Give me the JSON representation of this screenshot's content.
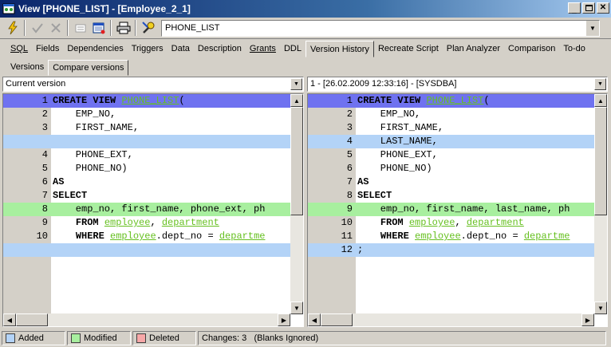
{
  "window": {
    "title": "View [PHONE_LIST] - [Employee_2_1]"
  },
  "toolbar": {
    "object_name": "PHONE_LIST"
  },
  "tabs": [
    {
      "label": "SQL",
      "active": false
    },
    {
      "label": "Fields",
      "active": false
    },
    {
      "label": "Dependencies",
      "active": false
    },
    {
      "label": "Triggers",
      "active": false
    },
    {
      "label": "Data",
      "active": false
    },
    {
      "label": "Description",
      "active": false
    },
    {
      "label": "Grants",
      "active": false
    },
    {
      "label": "DDL",
      "active": false
    },
    {
      "label": "Version History",
      "active": true
    },
    {
      "label": "Recreate Script",
      "active": false
    },
    {
      "label": "Plan Analyzer",
      "active": false
    },
    {
      "label": "Comparison",
      "active": false
    },
    {
      "label": "To-do",
      "active": false
    }
  ],
  "subtabs": [
    {
      "label": "Versions",
      "active": false
    },
    {
      "label": "Compare versions",
      "active": true
    }
  ],
  "left_version": "Current version",
  "right_version": "1 - [26.02.2009 12:33:16] - [SYSDBA]",
  "colors": {
    "added": "#b3d3f7",
    "modified": "#a8ef9f",
    "deleted": "#f7a8a8",
    "first_line": "#6f72f0"
  },
  "left_lines": [
    {
      "num": "1",
      "text": "CREATE VIEW PHONE_LIST("
    },
    {
      "num": "2",
      "text": "    EMP_NO,"
    },
    {
      "num": "3",
      "text": "    FIRST_NAME,"
    },
    {
      "num": "",
      "text": ""
    },
    {
      "num": "4",
      "text": "    PHONE_EXT,"
    },
    {
      "num": "5",
      "text": "    PHONE_NO)"
    },
    {
      "num": "6",
      "text": "AS"
    },
    {
      "num": "7",
      "text": "SELECT"
    },
    {
      "num": "8",
      "text": "    emp_no, first_name, phone_ext, ph"
    },
    {
      "num": "9",
      "text": "    FROM employee, department"
    },
    {
      "num": "10",
      "text": "    WHERE employee.dept_no = departme"
    },
    {
      "num": "",
      "text": ""
    }
  ],
  "right_lines": [
    {
      "num": "1",
      "text": "CREATE VIEW PHONE_LIST("
    },
    {
      "num": "2",
      "text": "    EMP_NO,"
    },
    {
      "num": "3",
      "text": "    FIRST_NAME,"
    },
    {
      "num": "4",
      "text": "    LAST_NAME,"
    },
    {
      "num": "5",
      "text": "    PHONE_EXT,"
    },
    {
      "num": "6",
      "text": "    PHONE_NO)"
    },
    {
      "num": "7",
      "text": "AS"
    },
    {
      "num": "8",
      "text": "SELECT"
    },
    {
      "num": "9",
      "text": "    emp_no, first_name, last_name, ph"
    },
    {
      "num": "10",
      "text": "    FROM employee, department"
    },
    {
      "num": "11",
      "text": "    WHERE employee.dept_no = departme"
    },
    {
      "num": "12",
      "text": ";"
    }
  ],
  "status": {
    "added": "Added",
    "modified": "Modified",
    "deleted": "Deleted",
    "changes": "Changes: 3",
    "blanks": "(Blanks Ignored)"
  }
}
